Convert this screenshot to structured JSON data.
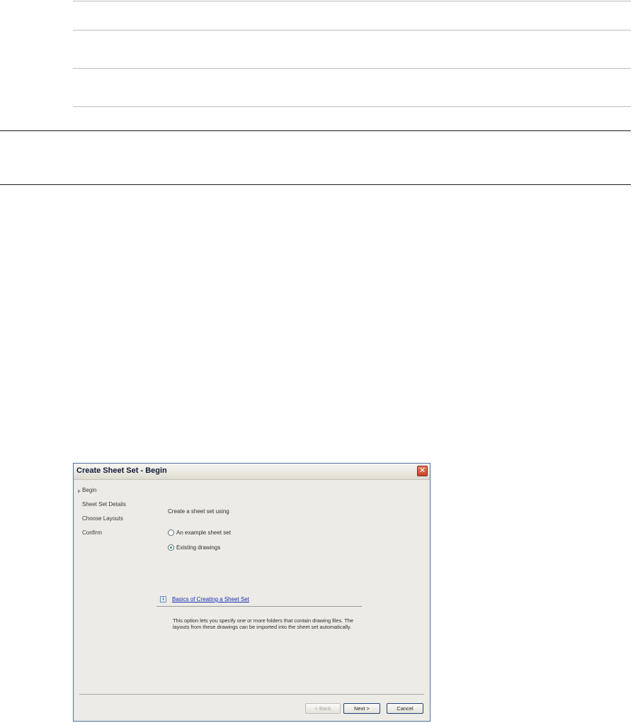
{
  "dialog": {
    "title": "Create Sheet Set - Begin",
    "close_icon": "close-icon",
    "nav_items": [
      {
        "label": "Begin",
        "current": true
      },
      {
        "label": "Sheet Set Details",
        "current": false
      },
      {
        "label": "Choose Layouts",
        "current": false
      },
      {
        "label": "Confirm",
        "current": false
      }
    ],
    "section_label": "Create a sheet set using",
    "options": [
      {
        "label": "An example sheet set",
        "selected": false
      },
      {
        "label": "Existing drawings",
        "selected": true
      }
    ],
    "info_icon": "info-icon",
    "info_link": "Basics of Creating a Sheet Set",
    "description": "This option lets you specify one or more folders that contain drawing files.  The layouts from these drawings can be imported into the sheet set automatically.",
    "buttons": {
      "back": "< Back",
      "next": "Next >",
      "cancel": "Cancel"
    }
  }
}
